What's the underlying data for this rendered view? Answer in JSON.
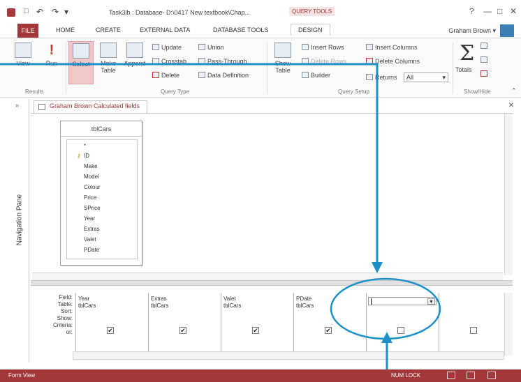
{
  "titlebar": {
    "title": "Task3lb : Database- D:\\0417 New textbook\\Chap...",
    "query_tools": "QUERY TOOLS",
    "help": "?",
    "minimize": "—",
    "restore": "□",
    "close": "✕",
    "undo": "↶",
    "redo": "↷",
    "qa_more": "▾"
  },
  "tabs": [
    "FILE",
    "HOME",
    "CREATE",
    "EXTERNAL DATA",
    "DATABASE TOOLS",
    "DESIGN"
  ],
  "user": "Graham Brown",
  "user_caret": "▾",
  "ribbon": {
    "results": {
      "view": "View",
      "run": "Run",
      "label": "Results"
    },
    "query_type": {
      "select": "Select",
      "make_table": "Make Table",
      "append": "Append",
      "update": "Update",
      "crosstab": "Crosstab",
      "delete": "Delete",
      "union": "Union",
      "pass_through": "Pass-Through",
      "data_definition": "Data Definition",
      "label": "Query Type"
    },
    "query_setup": {
      "show_table": "Show Table",
      "insert_rows": "Insert Rows",
      "delete_rows": "Delete Rows",
      "builder": "Builder",
      "insert_columns": "Insert Columns",
      "delete_columns": "Delete Columns",
      "returns": "Returns",
      "returns_value": "All",
      "label": "Query Setup"
    },
    "show_hide": {
      "totals": "Totals",
      "label": "Show/Hide",
      "sigma": "Σ"
    }
  },
  "nav": {
    "label": "Navigation Pane",
    "collapse": "»"
  },
  "doc_tab": "Graham Brown Calculated fields",
  "table": {
    "name": "tblCars",
    "fields": [
      "*",
      "ID",
      "Make",
      "Model",
      "Colour",
      "Price",
      "SPrice",
      "Year",
      "Extras",
      "Valet",
      "PDate"
    ],
    "key": "⚷"
  },
  "grid": {
    "row_labels": [
      "Field:",
      "Table:",
      "Sort:",
      "Show:",
      "Criteria:",
      "or:"
    ],
    "columns": [
      {
        "field": "Year",
        "table": "tblCars",
        "show": "✔"
      },
      {
        "field": "Extras",
        "table": "tblCars",
        "show": "✔"
      },
      {
        "field": "Valet",
        "table": "tblCars",
        "show": "✔"
      },
      {
        "field": "PDate",
        "table": "tblCars",
        "show": "✔"
      },
      {
        "field": "",
        "table": "",
        "show": ""
      },
      {
        "field": "",
        "table": "",
        "show": ""
      }
    ]
  },
  "status": {
    "left": "Form View",
    "numlock": "NUM LOCK"
  },
  "colors": {
    "accent": "#a4373a",
    "annotation": "#1d8fc9"
  }
}
